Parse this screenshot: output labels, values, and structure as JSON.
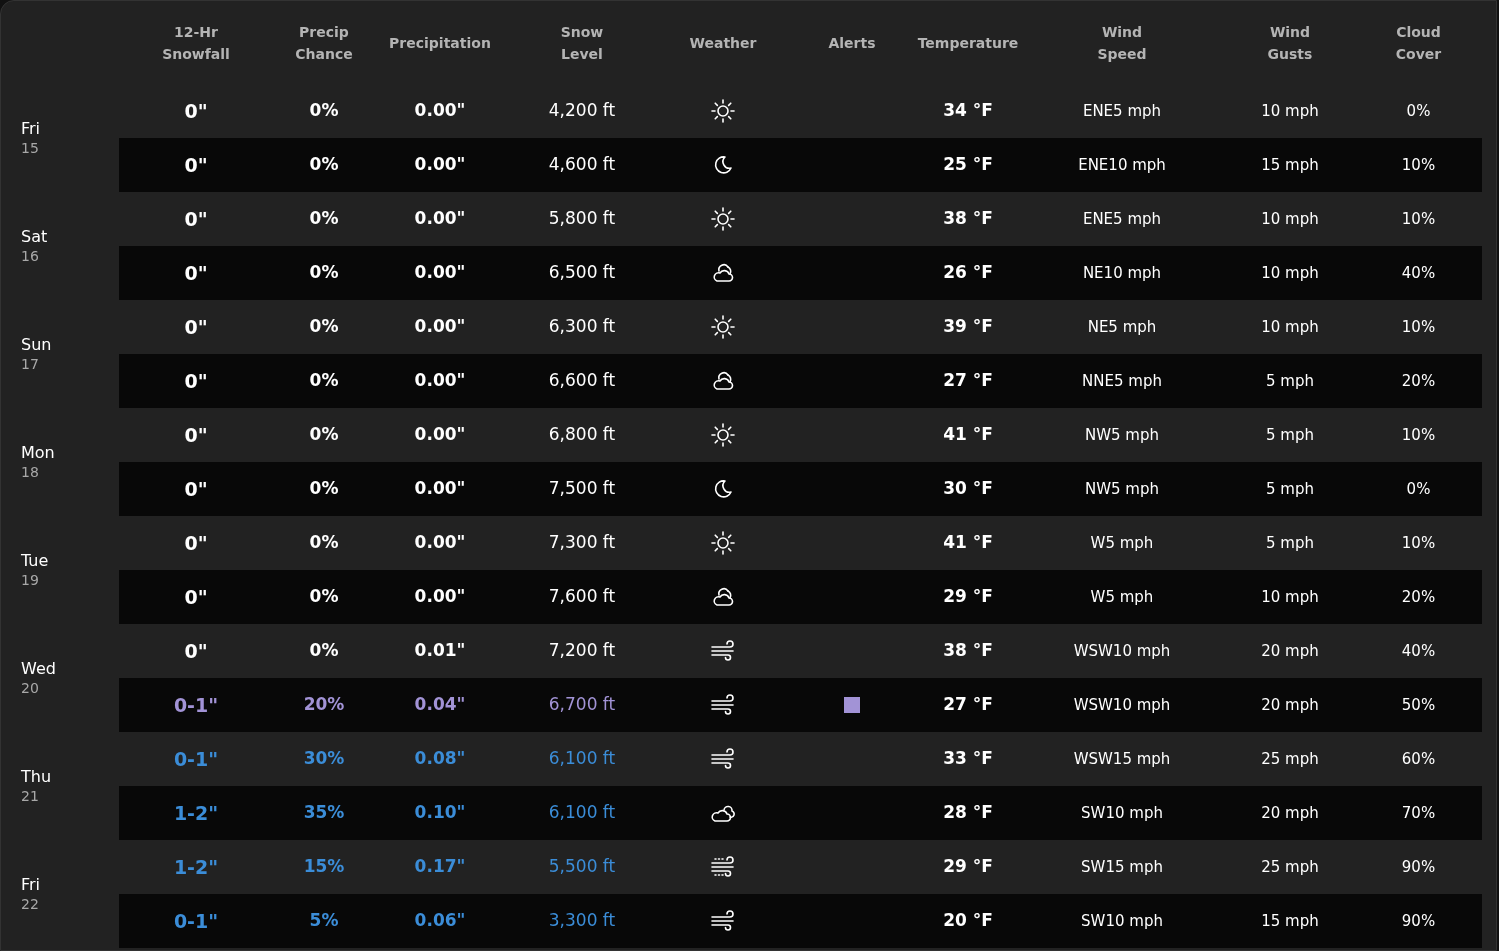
{
  "columns": [
    "12-Hr\nSnowfall",
    "Precip\nChance",
    "Precipitation",
    "Snow\nLevel",
    "Weather",
    "Alerts",
    "Temperature",
    "Wind\nSpeed",
    "Wind\nGusts",
    "Cloud\nCover"
  ],
  "days": [
    {
      "name": "Fri",
      "date": "15",
      "rows": [
        {
          "snowfall": "0\"",
          "chance": "0%",
          "precip": "0.00\"",
          "snow_level": "4,200 ft",
          "kind": "sun",
          "alert": false,
          "temperature": "34 °F",
          "wind": "ENE5 mph",
          "gusts": "10 mph",
          "cloud": "0%",
          "color": "#ffffff"
        },
        {
          "snowfall": "0\"",
          "chance": "0%",
          "precip": "0.00\"",
          "snow_level": "4,600 ft",
          "kind": "moon",
          "alert": false,
          "temperature": "25 °F",
          "wind": "ENE10 mph",
          "gusts": "15 mph",
          "cloud": "10%",
          "color": "#ffffff"
        }
      ]
    },
    {
      "name": "Sat",
      "date": "16",
      "rows": [
        {
          "snowfall": "0\"",
          "chance": "0%",
          "precip": "0.00\"",
          "snow_level": "5,800 ft",
          "kind": "sun",
          "alert": false,
          "temperature": "38 °F",
          "wind": "ENE5 mph",
          "gusts": "10 mph",
          "cloud": "10%",
          "color": "#ffffff"
        },
        {
          "snowfall": "0\"",
          "chance": "0%",
          "precip": "0.00\"",
          "snow_level": "6,500 ft",
          "kind": "partly",
          "alert": false,
          "temperature": "26 °F",
          "wind": "NE10 mph",
          "gusts": "10 mph",
          "cloud": "40%",
          "color": "#ffffff"
        }
      ]
    },
    {
      "name": "Sun",
      "date": "17",
      "rows": [
        {
          "snowfall": "0\"",
          "chance": "0%",
          "precip": "0.00\"",
          "snow_level": "6,300 ft",
          "kind": "sun",
          "alert": false,
          "temperature": "39 °F",
          "wind": "NE5 mph",
          "gusts": "10 mph",
          "cloud": "10%",
          "color": "#ffffff"
        },
        {
          "snowfall": "0\"",
          "chance": "0%",
          "precip": "0.00\"",
          "snow_level": "6,600 ft",
          "kind": "partly",
          "alert": false,
          "temperature": "27 °F",
          "wind": "NNE5 mph",
          "gusts": "5 mph",
          "cloud": "20%",
          "color": "#ffffff"
        }
      ]
    },
    {
      "name": "Mon",
      "date": "18",
      "rows": [
        {
          "snowfall": "0\"",
          "chance": "0%",
          "precip": "0.00\"",
          "snow_level": "6,800 ft",
          "kind": "sun",
          "alert": false,
          "temperature": "41 °F",
          "wind": "NW5 mph",
          "gusts": "5 mph",
          "cloud": "10%",
          "color": "#ffffff"
        },
        {
          "snowfall": "0\"",
          "chance": "0%",
          "precip": "0.00\"",
          "snow_level": "7,500 ft",
          "kind": "moon",
          "alert": false,
          "temperature": "30 °F",
          "wind": "NW5 mph",
          "gusts": "5 mph",
          "cloud": "0%",
          "color": "#ffffff"
        }
      ]
    },
    {
      "name": "Tue",
      "date": "19",
      "rows": [
        {
          "snowfall": "0\"",
          "chance": "0%",
          "precip": "0.00\"",
          "snow_level": "7,300 ft",
          "kind": "sun",
          "alert": false,
          "temperature": "41 °F",
          "wind": "W5 mph",
          "gusts": "5 mph",
          "cloud": "10%",
          "color": "#ffffff"
        },
        {
          "snowfall": "0\"",
          "chance": "0%",
          "precip": "0.00\"",
          "snow_level": "7,600 ft",
          "kind": "partly",
          "alert": false,
          "temperature": "29 °F",
          "wind": "W5 mph",
          "gusts": "10 mph",
          "cloud": "20%",
          "color": "#ffffff"
        }
      ]
    },
    {
      "name": "Wed",
      "date": "20",
      "rows": [
        {
          "snowfall": "0\"",
          "chance": "0%",
          "precip": "0.01\"",
          "snow_level": "7,200 ft",
          "kind": "wind",
          "alert": false,
          "temperature": "38 °F",
          "wind": "WSW10 mph",
          "gusts": "20 mph",
          "cloud": "40%",
          "color": "#ffffff"
        },
        {
          "snowfall": "0-1\"",
          "chance": "20%",
          "precip": "0.04\"",
          "snow_level": "6,700 ft",
          "kind": "wind",
          "alert": true,
          "temperature": "27 °F",
          "wind": "WSW10 mph",
          "gusts": "20 mph",
          "cloud": "50%",
          "color": "#a293d6"
        }
      ]
    },
    {
      "name": "Thu",
      "date": "21",
      "rows": [
        {
          "snowfall": "0-1\"",
          "chance": "30%",
          "precip": "0.08\"",
          "snow_level": "6,100 ft",
          "kind": "wind",
          "alert": false,
          "temperature": "33 °F",
          "wind": "WSW15 mph",
          "gusts": "25 mph",
          "cloud": "60%",
          "color": "#3b8dd8"
        },
        {
          "snowfall": "1-2\"",
          "chance": "35%",
          "precip": "0.10\"",
          "snow_level": "6,100 ft",
          "kind": "cloudy",
          "alert": false,
          "temperature": "28 °F",
          "wind": "SW10 mph",
          "gusts": "20 mph",
          "cloud": "70%",
          "color": "#3b8dd8"
        }
      ]
    },
    {
      "name": "Fri",
      "date": "22",
      "rows": [
        {
          "snowfall": "1-2\"",
          "chance": "15%",
          "precip": "0.17\"",
          "snow_level": "5,500 ft",
          "kind": "wind-snow",
          "alert": false,
          "temperature": "29 °F",
          "wind": "SW15 mph",
          "gusts": "25 mph",
          "cloud": "90%",
          "color": "#3b8dd8"
        },
        {
          "snowfall": "0-1\"",
          "chance": "5%",
          "precip": "0.06\"",
          "snow_level": "3,300 ft",
          "kind": "wind",
          "alert": false,
          "temperature": "20 °F",
          "wind": "SW10 mph",
          "gusts": "15 mph",
          "cloud": "90%",
          "color": "#3b8dd8"
        }
      ]
    }
  ]
}
